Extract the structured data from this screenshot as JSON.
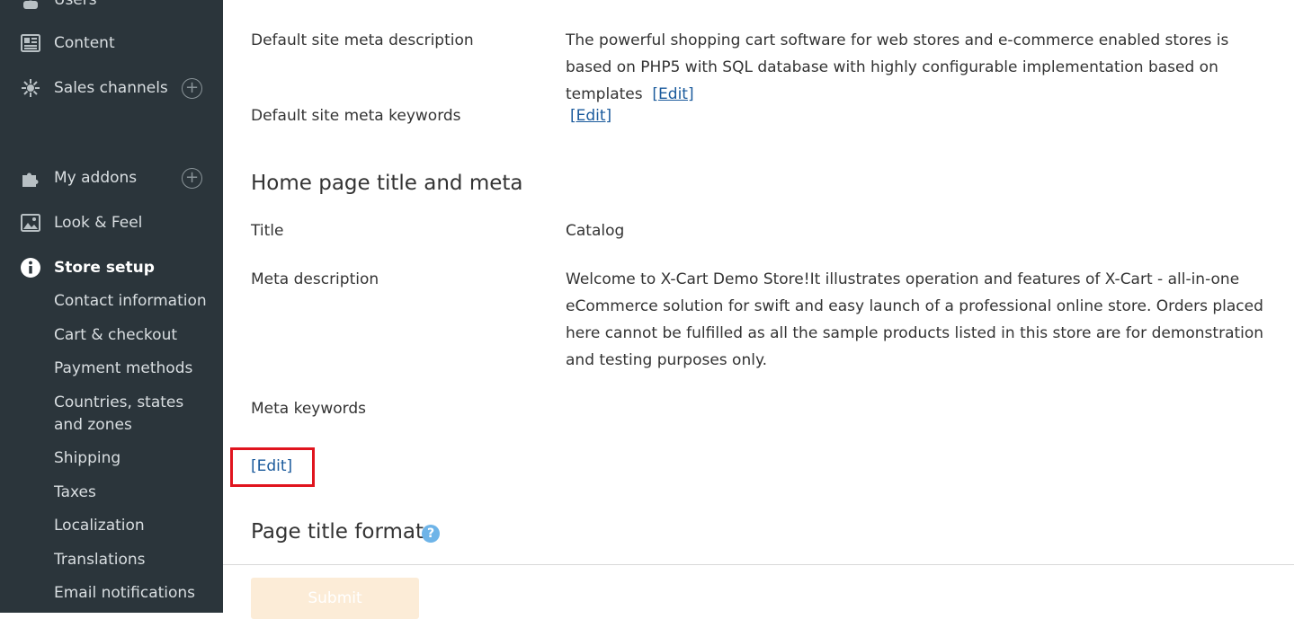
{
  "sidebar": {
    "items": [
      {
        "label": "Users",
        "icon": "user-icon"
      },
      {
        "label": "Content",
        "icon": "content-icon"
      },
      {
        "label": "Sales channels",
        "icon": "sales-channels-icon",
        "expandable": true
      },
      {
        "label": "My addons",
        "icon": "puzzle-icon",
        "expandable": true
      },
      {
        "label": "Look & Feel",
        "icon": "image-icon"
      },
      {
        "label": "Store setup",
        "icon": "info-icon",
        "active": true
      }
    ],
    "plus_symbol": "+",
    "submenu": [
      "Contact information",
      "Cart & checkout",
      "Payment methods",
      "Countries, states and zones",
      "Shipping",
      "Taxes",
      "Localization",
      "Translations",
      "Email notifications"
    ]
  },
  "main": {
    "default_meta": {
      "description_label": "Default site meta description",
      "description_value": "The powerful shopping cart software for web stores and e-commerce enabled stores is based on PHP5 with SQL database with highly configurable implementation based on templates",
      "keywords_label": "Default site meta keywords",
      "edit_label": "[Edit]"
    },
    "home_page": {
      "section_title": "Home page title and meta",
      "title_label": "Title",
      "title_value": "Catalog",
      "meta_description_label": "Meta description",
      "meta_description_value": "Welcome to X-Cart Demo Store!It illustrates operation and features of X-Cart - all-in-one eCommerce solution for swift and easy launch of a professional online store. Orders placed here cannot be fulfilled as all the sample products listed in this store are for demonstration and testing purposes only.",
      "meta_keywords_label": "Meta keywords",
      "edit_label": "[Edit]"
    },
    "page_title_format": {
      "section_title": "Page title format",
      "help_symbol": "?"
    },
    "submit_label": "Submit"
  },
  "colors": {
    "sidebar_bg": "#2b353b",
    "link": "#1a5a9c",
    "highlight": "#e0141e",
    "submit_bg": "#fcecd7",
    "help_icon": "#6eb4e8"
  }
}
